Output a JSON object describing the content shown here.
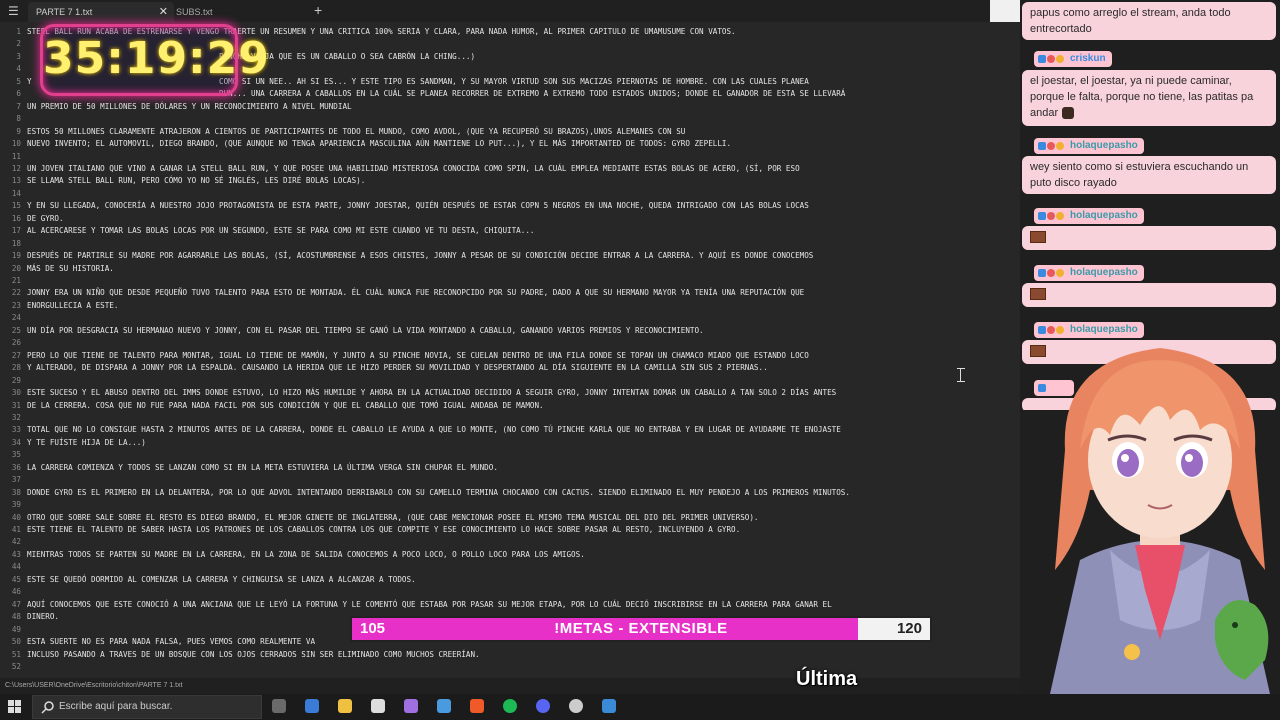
{
  "editor": {
    "tabs": [
      {
        "label": "PARTE 7 1.txt",
        "active": true
      },
      {
        "label": "SUBS.txt",
        "active": false
      }
    ],
    "close_symbol": "✕",
    "new_tab_symbol": "+",
    "status_path": "C:\\Users\\USER\\OneDrive\\Escritorio\\chiton\\PARTE 7 1.txt",
    "lines": [
      {
        "n": "1",
        "t": "STEEL BALL RUN ACABA DE ESTRENARSE Y VENGO TRAERTE UN RESUMEN Y UNA CRITICA 100% SERIA Y CLARA, PARA NADA HUMOR, AL PRIMER CAPITULO DE UMAMUSUME CON VATOS."
      },
      {
        "n": "2",
        "t": ""
      },
      {
        "n": "3",
        "t": "                                          PINCHE VIEJA QUE ES UN CABALLO O SEA CABRÓN LA CHING...)"
      },
      {
        "n": "4",
        "t": ""
      },
      {
        "n": "5",
        "t": "Y                                         COMO SI UN NEE.. AH SI ES... Y ESTE TIPO ES SANDMAN, Y SU MAYOR VIRTUD SON SUS MACIZAS PIERNOTAS DE HOMBRE. CON LAS CUALES PLANEA"
      },
      {
        "n": "6",
        "t": "                                          RUN... UNA CARRERA A CABALLOS EN LA CUÁL SE PLANEA RECORRER DE EXTREMO A EXTREMO TODO ESTADOS UNIDOS; DONDE EL GANADOR DE ESTA SE LLEVARÁ"
      },
      {
        "n": "7",
        "t": "UN PREMIO DE 50 MILLONES DE DÓLARES Y UN RECONOCIMIENTO A NIVEL MUNDIAL"
      },
      {
        "n": "8",
        "t": ""
      },
      {
        "n": "9",
        "t": "ESTOS 50 MILLONES CLARAMENTE ATRAJERON A CIENTOS DE PARTICIPANTES DE TODO EL MUNDO, COMO AVDOL, (QUE YA RECUPERÓ SU BRAZOS),UNOS ALEMANES CON SU"
      },
      {
        "n": "10",
        "t": "NUEVO INVENTO; EL AUTOMOVIL, DIEGO BRANDO, (QUE AUNQUE NO TENGA APARIENCIA MASCULINA AÚN MANTIENE LO PUT...), Y EL MÁS IMPORTANTED DE TODOS: GYRO ZEPELLI."
      },
      {
        "n": "11",
        "t": ""
      },
      {
        "n": "12",
        "t": "UN JOVEN ITALIANO QUE VINO A GANAR LA STELL BALL RUN, Y QUE POSEE UNA HABILIDAD MISTERIOSA CONOCIDA COMO SPIN, LA CUÁL EMPLEA MEDIANTE ESTAS BOLAS DE ACERO, (SÍ, POR ESO"
      },
      {
        "n": "13",
        "t": "SE LLAMA STELL BALL RUN, PERO CÓMO YO NO SÉ INGLÉS, LES DIRÉ BOLAS LOCAS)."
      },
      {
        "n": "14",
        "t": ""
      },
      {
        "n": "15",
        "t": "Y EN SU LLEGADA, CONOCERÍA A NUESTRO JOJO PROTAGONISTA DE ESTA PARTE, JONNY JOESTAR, QUIÉN DESPUÉS DE ESTAR COPN 5 NEGROS EN UNA NOCHE, QUEDA INTRIGADO CON LAS BOLAS LOCAS"
      },
      {
        "n": "16",
        "t": "DE GYRO."
      },
      {
        "n": "17",
        "t": "AL ACERCARESE Y TOMAR LAS BOLAS LOCAS POR UN SEGUNDO, ESTE SE PARA COMO MI ESTE CUANDO VE TU DESTA, CHIQUITA..."
      },
      {
        "n": "18",
        "t": ""
      },
      {
        "n": "19",
        "t": "DESPUÉS DE PARTIRLE SU MADRE POR AGARRARLE LAS BOLAS, (SÍ, ACOSTUMBRENSE A ESOS CHISTES, JONNY A PESAR DE SU CONDICIÓN DECIDE ENTRAR A LA CARRERA. Y AQUÍ ES DONDE CONOCEMOS"
      },
      {
        "n": "20",
        "t": "MÁS DE SU HISTORIA."
      },
      {
        "n": "21",
        "t": ""
      },
      {
        "n": "22",
        "t": "JONNY ERA UN NIÑO QUE DESDE PEQUEÑO TUVO TALENTO PARA ESTO DE MONTADA. ÉL CUÁL NUNCA FUE RECONOPCIDO POR SU PADRE, DADO A QUE SU HERMANO MAYOR YA TENÍA UNA REPUTACIÓN QUE"
      },
      {
        "n": "23",
        "t": "ENORGULLECIA A ESTE."
      },
      {
        "n": "24",
        "t": ""
      },
      {
        "n": "25",
        "t": "UN DÍA POR DESGRACIA SU HERMANAO NUEVO Y JONNY, CON EL PASAR DEL TIEMPO SE GANÓ LA VIDA MONTANDO A CABALLO, GANANDO VARIOS PREMIOS Y RECONOCIMIENTO."
      },
      {
        "n": "26",
        "t": ""
      },
      {
        "n": "27",
        "t": "PERO LO QUE TIENE DE TALENTO PARA MONTAR, IGUAL LO TIENE DE MAMÓN, Y JUNTO A SU PINCHE NOVIA, SE CUELAN DENTRO DE UNA FILA DONDE SE TOPAN UN CHAMACO MIADO QUE ESTANDO LOCO"
      },
      {
        "n": "28",
        "t": "Y ALTERADO, DE DISPARA A JONNY POR LA ESPALDA. CAUSANDO LA HERIDA QUE LE HIZO PERDER SU MOVILIDAD Y DESPERTANDO AL DÍA SIGUIENTE EN LA CAMILLA SIN SUS 2 PIERNAS.."
      },
      {
        "n": "29",
        "t": ""
      },
      {
        "n": "30",
        "t": "ESTE SUCESO Y EL ABUSO DENTRO DEL IMMS DONDE ESTUVO, LO HIZO MÁS HUMILDE Y AHORA EN LA ACTUALIDAD DECIDIDO A SEGUIR GYRO, JONNY INTENTAN DOMAR UN CABALLO A TAN SOLO 2 DÍAS ANTES"
      },
      {
        "n": "31",
        "t": "DE LA CERRERA. COSA QUE NO FUE PARA NADA FACIL POR SUS CONDICIÓN Y QUE EL CABALLO QUE TOMÓ IGUAL ANDABA DE MAMON."
      },
      {
        "n": "32",
        "t": ""
      },
      {
        "n": "33",
        "t": "TOTAL QUE NO LO CONSIGUE HASTA 2 MINUTOS ANTES DE LA CARRERA, DONDE EL CABALLO LE AYUDA A QUE LO MONTE, (NO COMO TÚ PINCHE KARLA QUE NO ENTRABA Y EN LUGAR DE AYUDARME TE ENOJASTE"
      },
      {
        "n": "34",
        "t": "Y TE FUÍSTE HIJA DE LA...)"
      },
      {
        "n": "35",
        "t": ""
      },
      {
        "n": "36",
        "t": "LA CARRERA COMIENZA Y TODOS SE LANZAN COMO SI EN LA META ESTUVIERA LA ÚLTIMA VERGA SIN CHUPAR EL MUNDO."
      },
      {
        "n": "37",
        "t": ""
      },
      {
        "n": "38",
        "t": "DONDE GYRO ES EL PRIMERO EN LA DELANTERA, POR LO QUE ADVOL INTENTANDO DERRIBARLO CON SU CAMELLO TERMINA CHOCANDO CON CACTUS. SIENDO ELIMINADO EL MUY PENDEJO A LOS PRIMEROS MINUTOS."
      },
      {
        "n": "39",
        "t": ""
      },
      {
        "n": "40",
        "t": "OTRO QUE SOBRE SALE SOBRE EL RESTO ES DIEGO BRANDO, EL MEJOR GINETE DE INGLATERRA, (QUE CABE MENCIONAR POSEE EL MISMO TEMA MUSICAL DEL DIO DEL PRIMER UNIVERSO)."
      },
      {
        "n": "41",
        "t": "ESTE TIENE EL TALENTO DE SABER HASTA LOS PATRONES DE LOS CABALLOS CONTRA LOS QUE COMPITE Y ESE CONOCIMIENTO LO HACE SOBRE PASAR AL RESTO, INCLUYENDO A GYRO."
      },
      {
        "n": "42",
        "t": ""
      },
      {
        "n": "43",
        "t": "MIENTRAS TODOS SE PARTEN SU MADRE EN LA CARRERA, EN LA ZONA DE SALIDA CONOCEMOS A POCO LOCO, O POLLO LOCO PARA LOS AMIGOS."
      },
      {
        "n": "44",
        "t": ""
      },
      {
        "n": "45",
        "t": "ESTE SE QUEDÓ DORMIDO AL COMENZAR LA CARRERA Y CHINGUISA SE LANZA A ALCANZAR A TODOS."
      },
      {
        "n": "46",
        "t": ""
      },
      {
        "n": "47",
        "t": "AQUÍ CONOCEMOS QUE ESTE CONOCIÓ A UNA ANCIANA QUE LE LEYÓ LA FORTUNA Y LE COMENTÓ QUE ESTABA POR PASAR SU MEJOR ETAPA, POR LO CUÁL DECIÓ INSCRIBIRSE EN LA CARRERA PARA GANAR EL"
      },
      {
        "n": "48",
        "t": "DINERO."
      },
      {
        "n": "49",
        "t": ""
      },
      {
        "n": "50",
        "t": "ESTA SUERTE NO ES PARA NADA FALSA, PUES VEMOS COMO REALMENTE VA"
      },
      {
        "n": "51",
        "t": "INCLUSO PASANDO A TRAVES DE UN BOSQUE CON LOS OJOS CERRADOS SIN SER ELIMINADO COMO MUCHOS CREERÍAN."
      },
      {
        "n": "52",
        "t": ""
      }
    ]
  },
  "timer": {
    "value": "35:19:29"
  },
  "chat": {
    "messages": [
      {
        "user": "",
        "text": "papus como arreglo el stream, anda todo entrecortado",
        "emote": false
      },
      {
        "user": "criskun",
        "text": "el joestar, el joestar, ya ni puede caminar, porque le falta, porque no tiene, las patitas pa andar",
        "emote": false
      },
      {
        "user": "holaquepasho",
        "text": "wey siento como si estuviera escuchando un puto disco rayado",
        "emote": false
      },
      {
        "user": "holaquepasho",
        "text": "",
        "emote": true
      },
      {
        "user": "holaquepasho",
        "text": "",
        "emote": true
      },
      {
        "user": "holaquepasho",
        "text": "",
        "emote": true
      }
    ]
  },
  "goal": {
    "current": "105",
    "label": "!METAS - EXTENSIBLE",
    "target": "120",
    "progress": 0.875,
    "fill_color": "#e630c8"
  },
  "caption": "Última",
  "taskbar": {
    "search_placeholder": "Escribe aquí para buscar.",
    "icons": [
      "task-view-icon",
      "app-icon",
      "file-explorer-icon",
      "notepad-icon",
      "pen-icon",
      "store-icon",
      "brave-icon",
      "spotify-icon",
      "discord-icon",
      "obs-icon",
      "editor-icon"
    ]
  },
  "colors": {
    "chat_bubble": "#f9d3dc",
    "username": "#3a9aa8",
    "timer_text": "#fff070",
    "timer_border": "#e0408c"
  }
}
